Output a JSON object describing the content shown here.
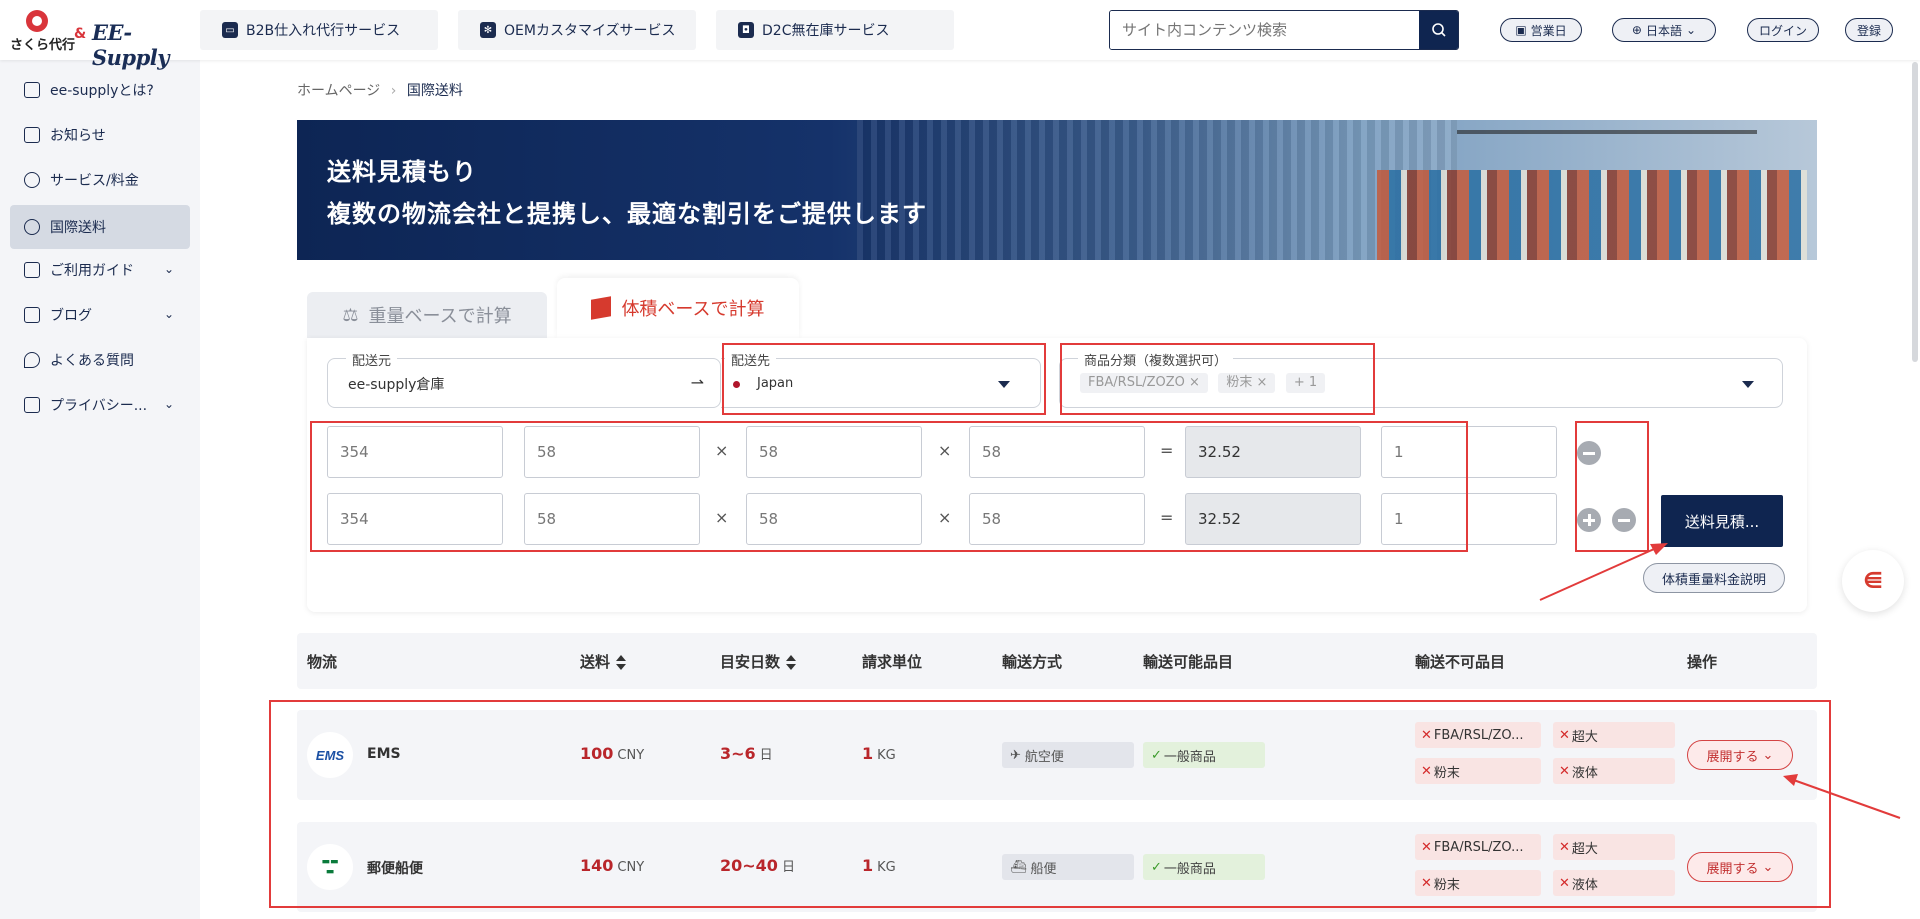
{
  "header": {
    "logo_jp": "さくら代行",
    "logo_amp": "&",
    "logo_brand": "EE-Supply",
    "services": [
      "B2B仕入れ代行サービス",
      "OEMカスタマイズサービス",
      "D2C無在庫サービス"
    ],
    "search_placeholder": "サイト内コンテンツ検索",
    "business_days": "営業日",
    "language": "日本語",
    "login": "ログイン",
    "register": "登録"
  },
  "sidebar": {
    "items": [
      {
        "label": "ee-supplyとは?",
        "icon": "home-icon"
      },
      {
        "label": "お知らせ",
        "icon": "megaphone-icon"
      },
      {
        "label": "サービス/料金",
        "icon": "yen-icon"
      },
      {
        "label": "国際送料",
        "icon": "globe-icon"
      },
      {
        "label": "ご利用ガイド",
        "icon": "guide-icon"
      },
      {
        "label": "ブログ",
        "icon": "blog-icon"
      },
      {
        "label": "よくある質問",
        "icon": "faq-icon"
      },
      {
        "label": "プライバシー...",
        "icon": "privacy-icon"
      }
    ]
  },
  "breadcrumb": {
    "home": "ホームページ",
    "sep": "›",
    "current": "国際送料"
  },
  "banner": {
    "title": "送料見積もり",
    "subtitle": "複数の物流会社と提携し、最適な割引をご提供します"
  },
  "tabs": {
    "weight": "重量ベースで計算",
    "volume": "体積ベースで計算"
  },
  "form": {
    "origin_label": "配送元",
    "origin_value": "ee-supply倉庫",
    "dest_label": "配送先",
    "dest_value": "Japan",
    "category_label": "商品分類（複数選択可）",
    "category_tags": [
      "FBA/RSL/ZOZO",
      "粉末"
    ],
    "category_more": "+ 1",
    "rows": [
      {
        "weight": "354",
        "l": "58",
        "w": "58",
        "h": "58",
        "vol": "32.52",
        "qty": "1"
      },
      {
        "weight": "354",
        "l": "58",
        "w": "58",
        "h": "58",
        "vol": "32.52",
        "qty": "1"
      }
    ],
    "times": "×",
    "equals": "=",
    "quote_button": "送料見積...",
    "explain_button": "体積重量料金説明"
  },
  "table": {
    "headers": [
      "物流",
      "送料",
      "目安日数",
      "請求単位",
      "輸送方式",
      "輸送可能品目",
      "輸送不可品目",
      "操作"
    ],
    "rows": [
      {
        "name": "EMS",
        "fee": "100",
        "fee_unit": "CNY",
        "days": "3~6",
        "days_unit": "日",
        "billing": "1",
        "billing_unit": "KG",
        "method": "航空便",
        "allowed": "一般商品",
        "banned": [
          "FBA/RSL/ZO...",
          "超大",
          "粉末",
          "液体"
        ],
        "action": "展開する"
      },
      {
        "name": "郵便船便",
        "fee": "140",
        "fee_unit": "CNY",
        "days": "20~40",
        "days_unit": "日",
        "billing": "1",
        "billing_unit": "KG",
        "method": "船便",
        "allowed": "一般商品",
        "banned": [
          "FBA/RSL/ZO...",
          "超大",
          "粉末",
          "液体"
        ],
        "action": "展開する"
      }
    ]
  },
  "colors": {
    "navy": "#0f2550",
    "accent_red": "#d63a2e",
    "annotation_red": "#e23b3b"
  }
}
